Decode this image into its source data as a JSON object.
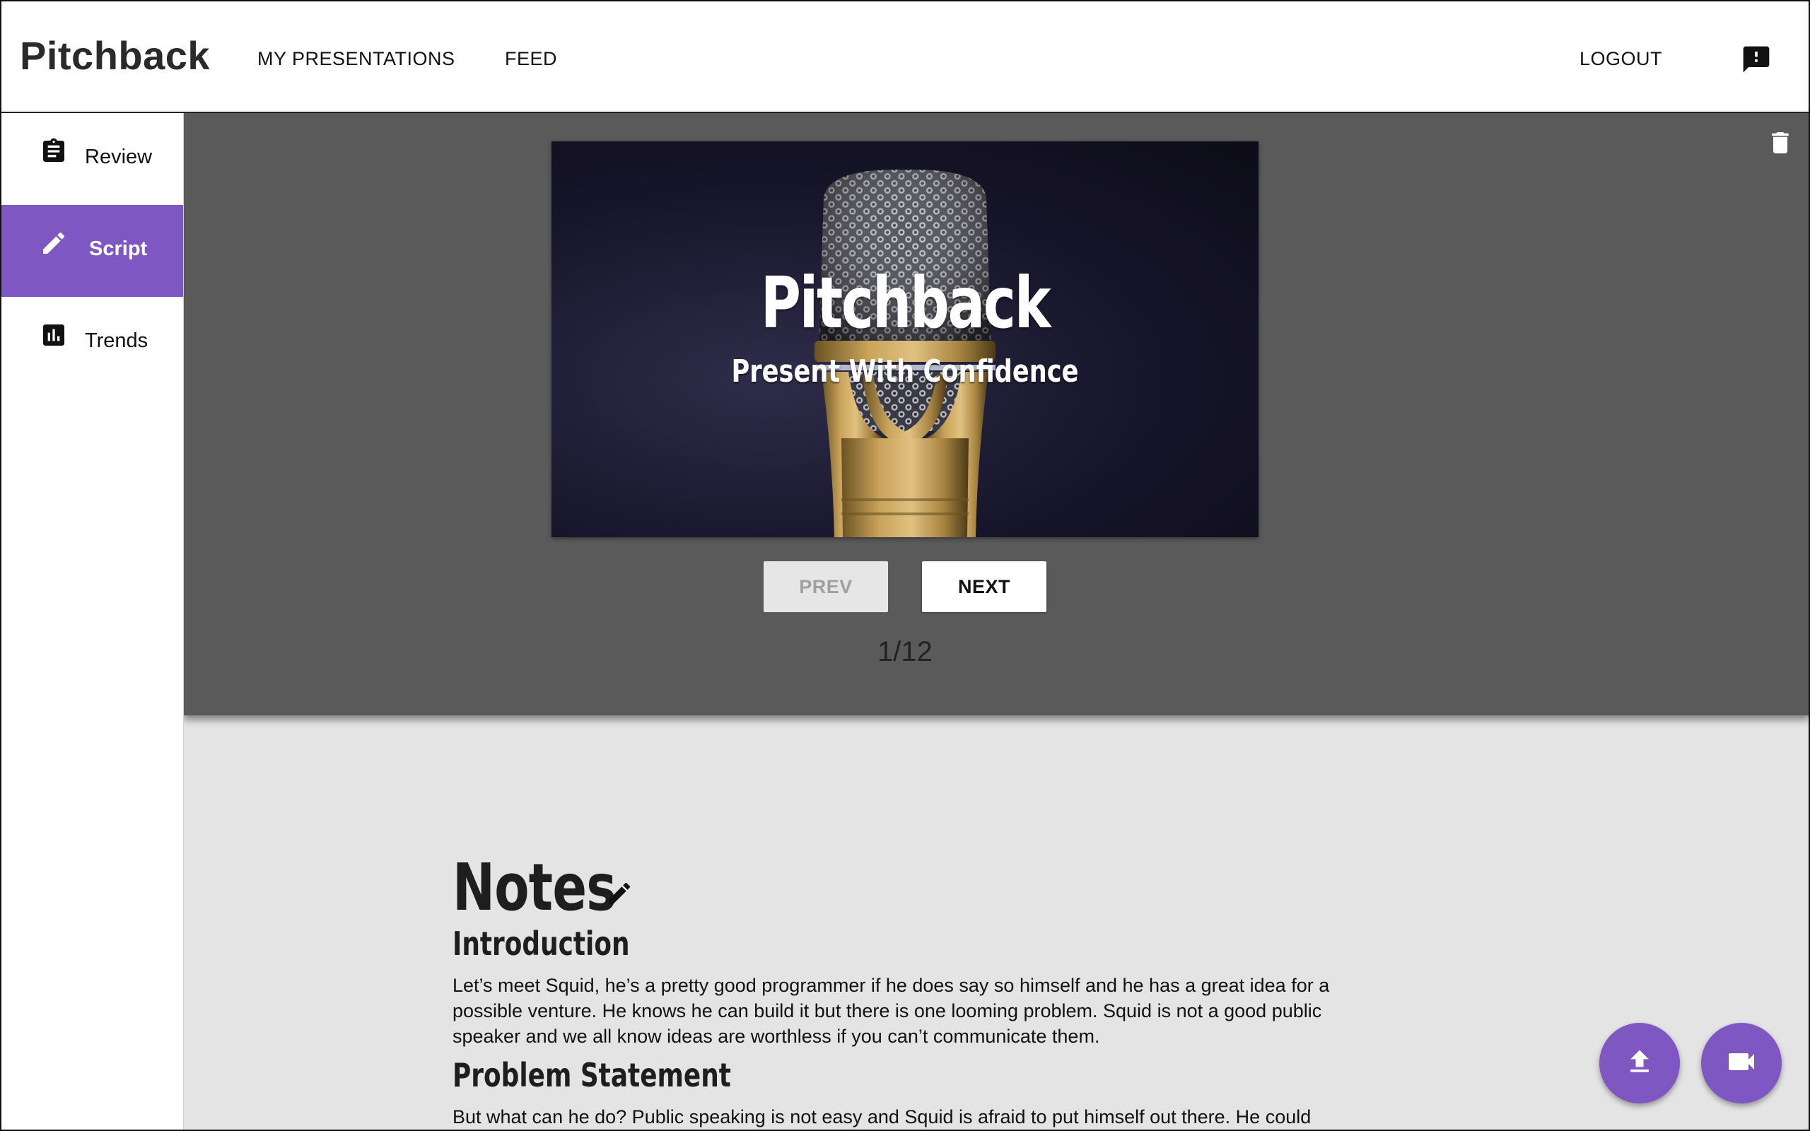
{
  "header": {
    "brand": "Pitchback",
    "nav": {
      "my_presentations": "MY PRESENTATIONS",
      "feed": "FEED",
      "logout": "LOGOUT"
    },
    "feedback_icon": "feedback-icon"
  },
  "sidebar": {
    "items": [
      {
        "label": "Review",
        "icon": "clipboard-icon",
        "active": false
      },
      {
        "label": "Script",
        "icon": "pencil-icon",
        "active": true
      },
      {
        "label": "Trends",
        "icon": "bar-chart-icon",
        "active": false
      }
    ],
    "accent": "#7e57c2"
  },
  "slide": {
    "title": "Pitchback",
    "subtitle": "Present With Confidence",
    "prev_label": "PREV",
    "next_label": "NEXT",
    "counter": "1/12",
    "delete_icon": "trash-icon"
  },
  "notes": {
    "title": "Notes",
    "edit_icon": "pencil-icon",
    "sections": [
      {
        "heading": "Introduction",
        "body": "Let’s meet Squid, he’s a pretty good programmer if he does say so himself and he has a great idea for a possible venture. He knows he can build it but there is one looming problem. Squid is not a good public speaker and we all know ideas are worthless if you can’t communicate them."
      },
      {
        "heading": "Problem Statement",
        "body": "But what can he do? Public speaking is not easy and Squid is afraid to put himself out there. He could"
      }
    ]
  },
  "fabs": {
    "upload_icon": "upload-icon",
    "video_icon": "videocam-icon"
  }
}
